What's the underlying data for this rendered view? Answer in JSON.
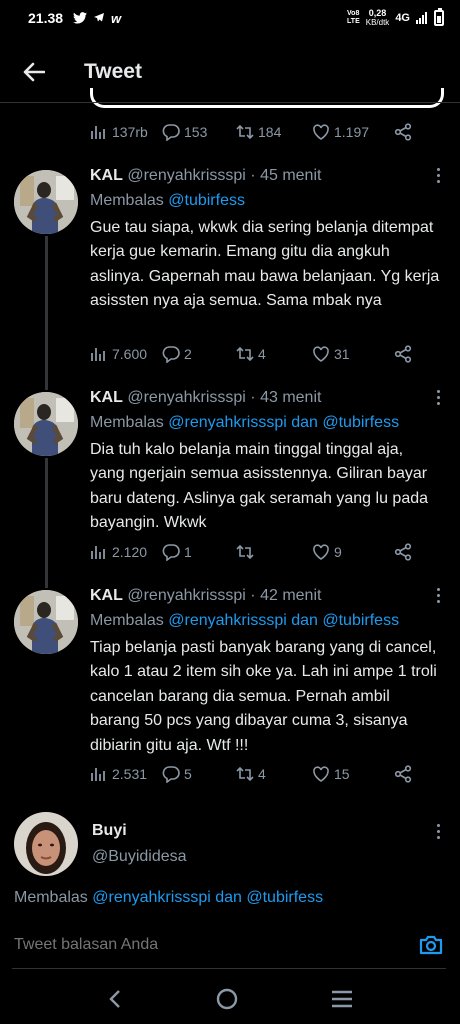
{
  "status_bar": {
    "time": "21.38",
    "volte_top": "Vo8",
    "volte_bottom": "LTE",
    "net_speed_value": "0,28",
    "net_speed_unit": "KB/dtk",
    "network": "4G"
  },
  "header": {
    "title": "Tweet"
  },
  "top_actions": {
    "views": "137rb",
    "replies": "153",
    "retweets": "184",
    "likes": "1.197"
  },
  "tweets": [
    {
      "name": "KAL",
      "handle": "@renyahkrissspi",
      "time": "· 45 menit",
      "reply_prefix": "Membalas",
      "reply_mentions": "@tubirfess",
      "body": "Gue tau siapa, wkwk dia sering belanja ditempat kerja gue kemarin. Emang gitu dia angkuh aslinya. Gapernah mau bawa belanjaan. Yg kerja asissten nya aja semua. Sama mbak nya",
      "views": "7.600",
      "replies": "2",
      "retweets": "4",
      "likes": "31"
    },
    {
      "name": "KAL",
      "handle": "@renyahkrissspi",
      "time": "· 43 menit",
      "reply_prefix": "Membalas",
      "reply_mentions": "@renyahkrissspi dan @tubirfess",
      "body": "Dia tuh kalo belanja main tinggal tinggal aja, yang ngerjain semua asisstennya. Giliran bayar baru dateng. Aslinya gak seramah yang lu pada bayangin. Wkwk",
      "views": "2.120",
      "replies": "1",
      "retweets": "",
      "likes": "9"
    },
    {
      "name": "KAL",
      "handle": "@renyahkrissspi",
      "time": "· 42 menit",
      "reply_prefix": "Membalas",
      "reply_mentions": "@renyahkrissspi dan @tubirfess",
      "body": "Tiap belanja pasti banyak barang yang di cancel, kalo 1 atau 2 item sih oke ya. Lah ini ampe 1 troli cancelan barang dia semua. Pernah ambil barang 50 pcs yang dibayar cuma 3, sisanya dibiarin gitu aja. Wtf !!!",
      "views": "2.531",
      "replies": "5",
      "retweets": "4",
      "likes": "15"
    }
  ],
  "composer": {
    "user_name": "Buyi",
    "user_handle": "@Buyididesa",
    "reply_prefix": "Membalas",
    "reply_mentions": "@renyahkrissspi dan @tubirfess",
    "placeholder": "Tweet balasan Anda"
  },
  "colors": {
    "accent": "#1d9bf0",
    "muted": "#8b98a5",
    "background": "#000000"
  }
}
